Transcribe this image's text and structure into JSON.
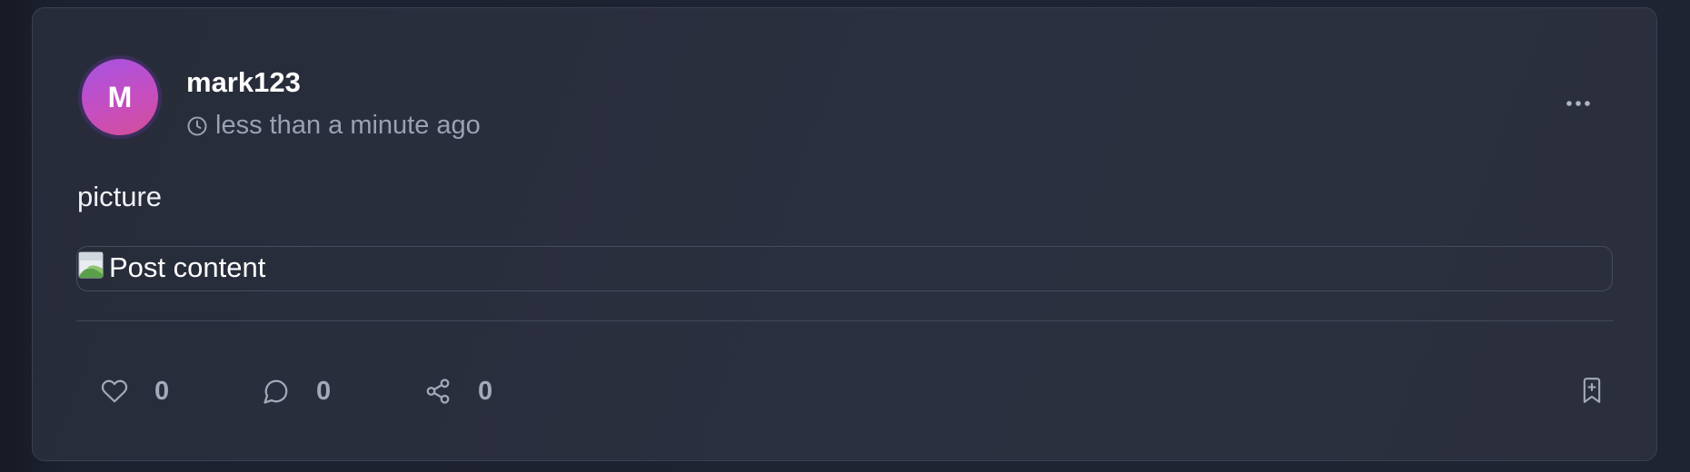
{
  "post": {
    "author": {
      "initial": "M",
      "username": "mark123"
    },
    "timestamp": "less than a minute ago",
    "text": "picture",
    "image_alt": "Post content",
    "stats": {
      "likes": "0",
      "comments": "0",
      "shares": "0"
    }
  },
  "icons": {
    "time": "clock-icon",
    "menu": "more-horizontal-icon",
    "like": "heart-icon",
    "comment": "message-circle-icon",
    "share": "share-icon",
    "bookmark": "bookmark-plus-icon"
  },
  "colors": {
    "background": "#1f2432",
    "card": "#2b3040",
    "avatar_gradient_start": "#a653e3",
    "avatar_gradient_end": "#d44f97",
    "muted_text": "#9aa1b1"
  }
}
